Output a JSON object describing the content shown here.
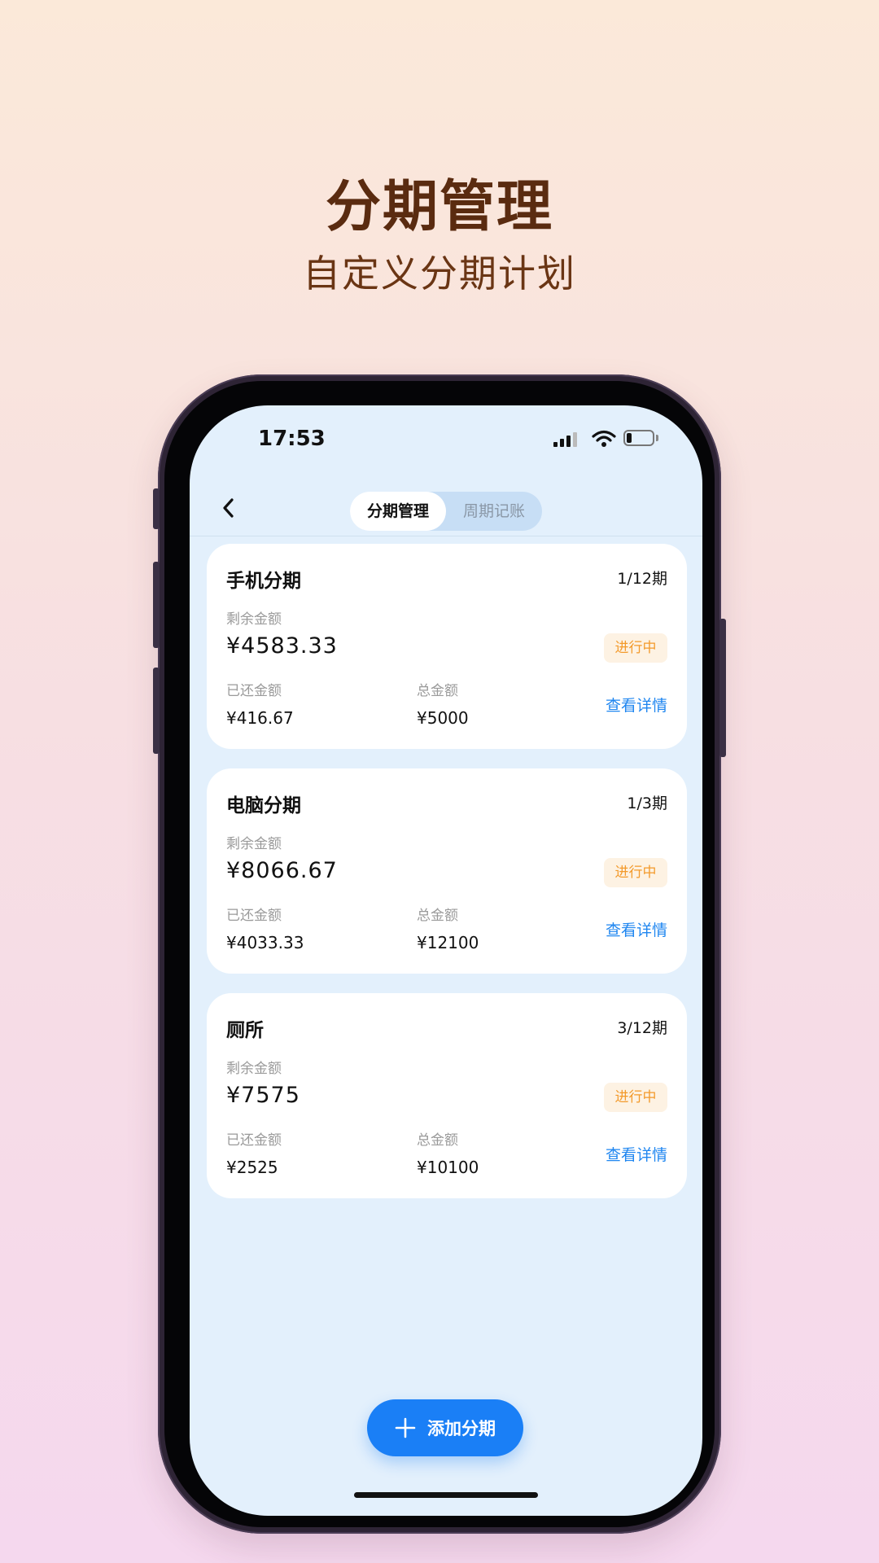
{
  "hero": {
    "title": "分期管理",
    "subtitle": "自定义分期计划"
  },
  "status_bar": {
    "time": "17:53",
    "battery_level": 0.2
  },
  "nav": {
    "back_icon": "chevron-left-icon",
    "tabs": [
      {
        "label": "分期管理",
        "active": true
      },
      {
        "label": "周期记账",
        "active": false
      }
    ]
  },
  "cards": [
    {
      "title": "手机分期",
      "progress": "1/12期",
      "remaining_label": "剩余金额",
      "remaining": "¥4583.33",
      "status": "进行中",
      "paid_label": "已还金额",
      "paid": "¥416.67",
      "total_label": "总金额",
      "total": "¥5000",
      "detail_link": "查看详情"
    },
    {
      "title": "电脑分期",
      "progress": "1/3期",
      "remaining_label": "剩余金额",
      "remaining": "¥8066.67",
      "status": "进行中",
      "paid_label": "已还金额",
      "paid": "¥4033.33",
      "total_label": "总金额",
      "total": "¥12100",
      "detail_link": "查看详情"
    },
    {
      "title": "厕所",
      "progress": "3/12期",
      "remaining_label": "剩余金额",
      "remaining": "¥7575",
      "status": "进行中",
      "paid_label": "已还金额",
      "paid": "¥2525",
      "total_label": "总金额",
      "total": "¥10100",
      "detail_link": "查看详情"
    }
  ],
  "fab": {
    "label": "添加分期",
    "icon": "plus-icon"
  },
  "colors": {
    "hero_text": "#5a2b10",
    "screen_bg": "#e3f0fc",
    "accent_blue": "#1a7ff6",
    "status_orange": "#f39a2b"
  }
}
